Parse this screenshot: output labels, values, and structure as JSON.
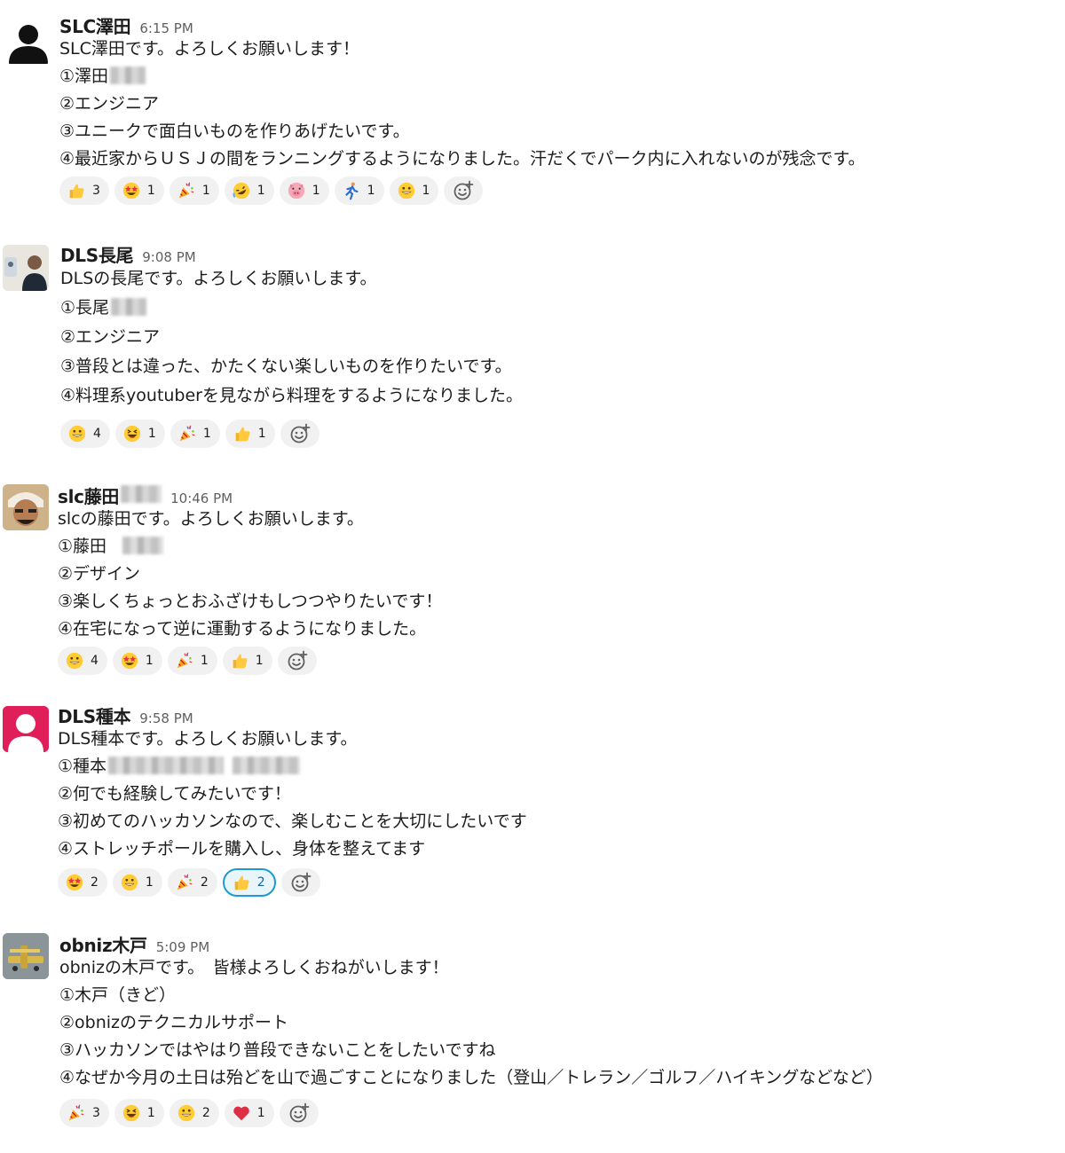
{
  "messages": [
    {
      "author": "SLC澤田",
      "time": "6:15 PM",
      "avatar": "default-person-avatar",
      "lines": [
        "SLC澤田です。よろしくお願いします！",
        "①澤田",
        "②エンジニア",
        "③ユニークで面白いものを作りあげたいです。",
        "④最近家からＵＳＪの間をランニングするようになりました。汗だくでパーク内に入れないのが残念です。"
      ],
      "reactions": [
        {
          "emoji": "thumbs-up",
          "count": "3"
        },
        {
          "emoji": "star-struck",
          "count": "1"
        },
        {
          "emoji": "tada",
          "count": "1"
        },
        {
          "emoji": "rofl",
          "count": "1"
        },
        {
          "emoji": "pig",
          "count": "1"
        },
        {
          "emoji": "runner",
          "count": "1"
        },
        {
          "emoji": "grinning",
          "count": "1"
        }
      ]
    },
    {
      "author": "DLS長尾",
      "time": "9:08 PM",
      "avatar": "photo-avatar-person",
      "lines": [
        "DLSの長尾です。よろしくお願いします。",
        "①長尾",
        "②エンジニア",
        "③普段とは違った、かたくない楽しいものを作りたいです。",
        "④料理系youtuberを見ながら料理をするようになりました。"
      ],
      "reactions": [
        {
          "emoji": "grinning",
          "count": "4"
        },
        {
          "emoji": "laughing",
          "count": "1"
        },
        {
          "emoji": "tada",
          "count": "1"
        },
        {
          "emoji": "thumbs-up",
          "count": "1"
        }
      ]
    },
    {
      "author": "slc藤田",
      "time": "10:46 PM",
      "avatar": "photo-avatar-cartoon",
      "lines": [
        "slcの藤田です。よろしくお願いします。",
        "①藤田",
        "②デザイン",
        "③楽しくちょっとおふざけもしつつやりたいです！",
        "④在宅になって逆に運動するようになりました。"
      ],
      "reactions": [
        {
          "emoji": "grinning",
          "count": "4"
        },
        {
          "emoji": "star-struck",
          "count": "1"
        },
        {
          "emoji": "tada",
          "count": "1"
        },
        {
          "emoji": "thumbs-up",
          "count": "1"
        }
      ]
    },
    {
      "author": "DLS種本",
      "time": "9:58 PM",
      "avatar": "default-person-avatar-pink",
      "lines": [
        "DLS種本です。よろしくお願いします。",
        "①種本",
        "②何でも経験してみたいです！",
        "③初めてのハッカソンなので、楽しむことを大切にしたいです",
        "④ストレッチポールを購入し、身体を整えてます"
      ],
      "reactions": [
        {
          "emoji": "star-struck",
          "count": "2"
        },
        {
          "emoji": "grinning",
          "count": "1"
        },
        {
          "emoji": "tada",
          "count": "2"
        },
        {
          "emoji": "thumbs-up",
          "count": "2",
          "active": true
        }
      ]
    },
    {
      "author": "obniz木戸",
      "time": "5:09 PM",
      "avatar": "photo-avatar-airplane",
      "lines": [
        "obnizの木戸です。　皆様よろしくおねがいします！",
        "①木戸（きど）",
        "②obnizのテクニカルサポート",
        "③ハッカソンではやはり普段できないことをしたいですね",
        "④なぜか今月の土日は殆どを山で過ごすことになりました（登山／トレラン／ゴルフ／ハイキングなどなど）"
      ],
      "reactions": [
        {
          "emoji": "tada",
          "count": "3"
        },
        {
          "emoji": "laughing",
          "count": "1"
        },
        {
          "emoji": "grinning",
          "count": "2"
        },
        {
          "emoji": "heart",
          "count": "1"
        }
      ]
    }
  ],
  "add_reaction_icon": "add-reaction-icon"
}
